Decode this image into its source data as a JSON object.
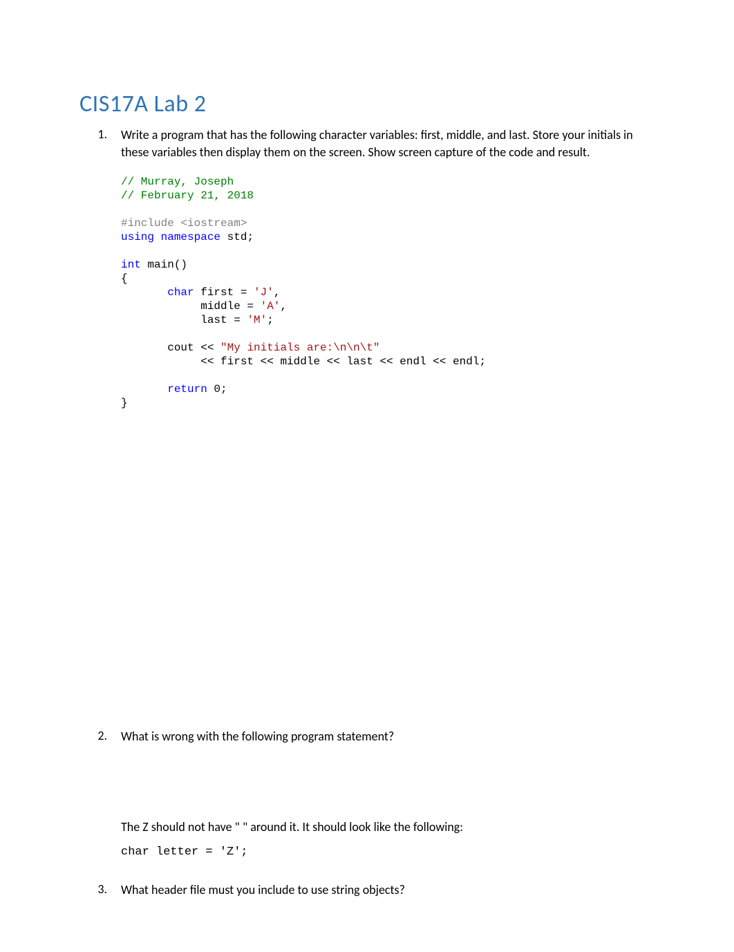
{
  "title": "CIS17A Lab 2",
  "q1": {
    "number": "1.",
    "text": "Write a program that has the following character variables: first, middle, and last. Store your initials in these variables then display them on the screen. Show screen capture of the code and result."
  },
  "code": {
    "c1": "// Murray, Joseph",
    "c2": "// February 21, 2018",
    "inc": "#include ",
    "inc_h": "<iostream>",
    "using": "using",
    "namespace": " namespace",
    "std": " std;",
    "int": "int",
    "main": " main()",
    "brace_open": "{",
    "indent1": "       ",
    "char": "char",
    "first_decl": " first = ",
    "first_val": "'J'",
    "comma1": ",",
    "indent2": "            ",
    "middle_decl": "middle = ",
    "middle_val": "'A'",
    "comma2": ",",
    "last_decl": "last = ",
    "last_val": "'M'",
    "semi1": ";",
    "cout": "cout << ",
    "str1": "\"My initials are:\\n\\n\\t\"",
    "line2_indent": "            ",
    "line2": "<< first << middle << last << endl << endl;",
    "return": "return",
    "return_val": " 0;",
    "brace_close": "}"
  },
  "q2": {
    "number": "2.",
    "text": "What is wrong with the following program statement?",
    "answer1": "The Z should not have \" \" around it.  It should look like the following:",
    "answer2": "char letter = 'Z';"
  },
  "q3": {
    "number": "3.",
    "text": "What header file must you include to use string objects?"
  }
}
